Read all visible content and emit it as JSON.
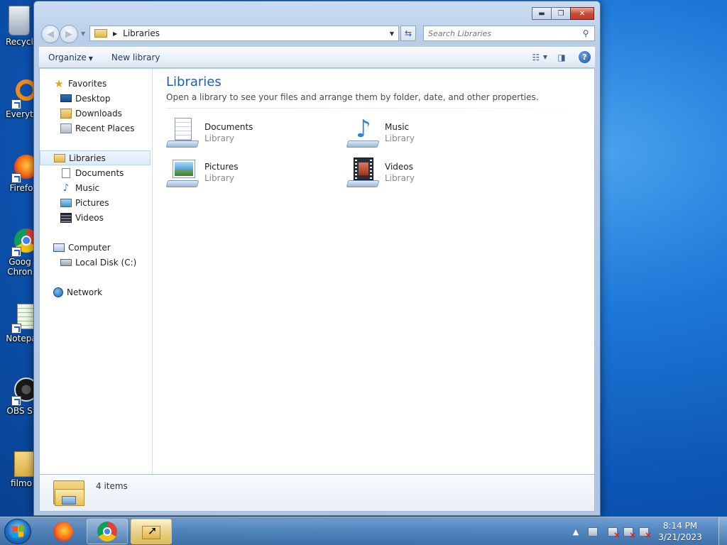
{
  "desktop": {
    "icons": [
      {
        "label": "Recycle",
        "icon": "recycle-bin-icon"
      },
      {
        "label": "Everyth",
        "icon": "everything-search-icon"
      },
      {
        "label": "Firefo",
        "icon": "firefox-icon"
      },
      {
        "label": "Goog Chron",
        "icon": "chrome-icon"
      },
      {
        "label": "Notepa",
        "icon": "notepad-icon"
      },
      {
        "label": "OBS St",
        "icon": "obs-icon"
      },
      {
        "label": "filmo",
        "icon": "folder-icon"
      }
    ]
  },
  "window": {
    "controls": {
      "minimize": "▬",
      "maximize": "❐",
      "close": "✕"
    }
  },
  "address": {
    "crumb": "Libraries",
    "search_placeholder": "Search Libraries"
  },
  "toolbar": {
    "organize": "Organize",
    "new_library": "New library"
  },
  "nav": {
    "favorites": {
      "label": "Favorites",
      "items": [
        "Desktop",
        "Downloads",
        "Recent Places"
      ]
    },
    "libraries": {
      "label": "Libraries",
      "items": [
        "Documents",
        "Music",
        "Pictures",
        "Videos"
      ]
    },
    "computer": {
      "label": "Computer",
      "items": [
        "Local Disk (C:)"
      ]
    },
    "network": {
      "label": "Network"
    }
  },
  "content": {
    "title": "Libraries",
    "subtitle": "Open a library to see your files and arrange them by folder, date, and other properties.",
    "libraries": [
      {
        "name": "Documents",
        "kind": "Library"
      },
      {
        "name": "Music",
        "kind": "Library"
      },
      {
        "name": "Pictures",
        "kind": "Library"
      },
      {
        "name": "Videos",
        "kind": "Library"
      }
    ]
  },
  "details": {
    "count": "4 items"
  },
  "taskbar": {
    "time": "8:14 PM",
    "date": "3/21/2023"
  },
  "colors": {
    "accent_title": "#1e5fb3",
    "desktop_blue": "#1e78d8",
    "close_red": "#c74f3a"
  }
}
